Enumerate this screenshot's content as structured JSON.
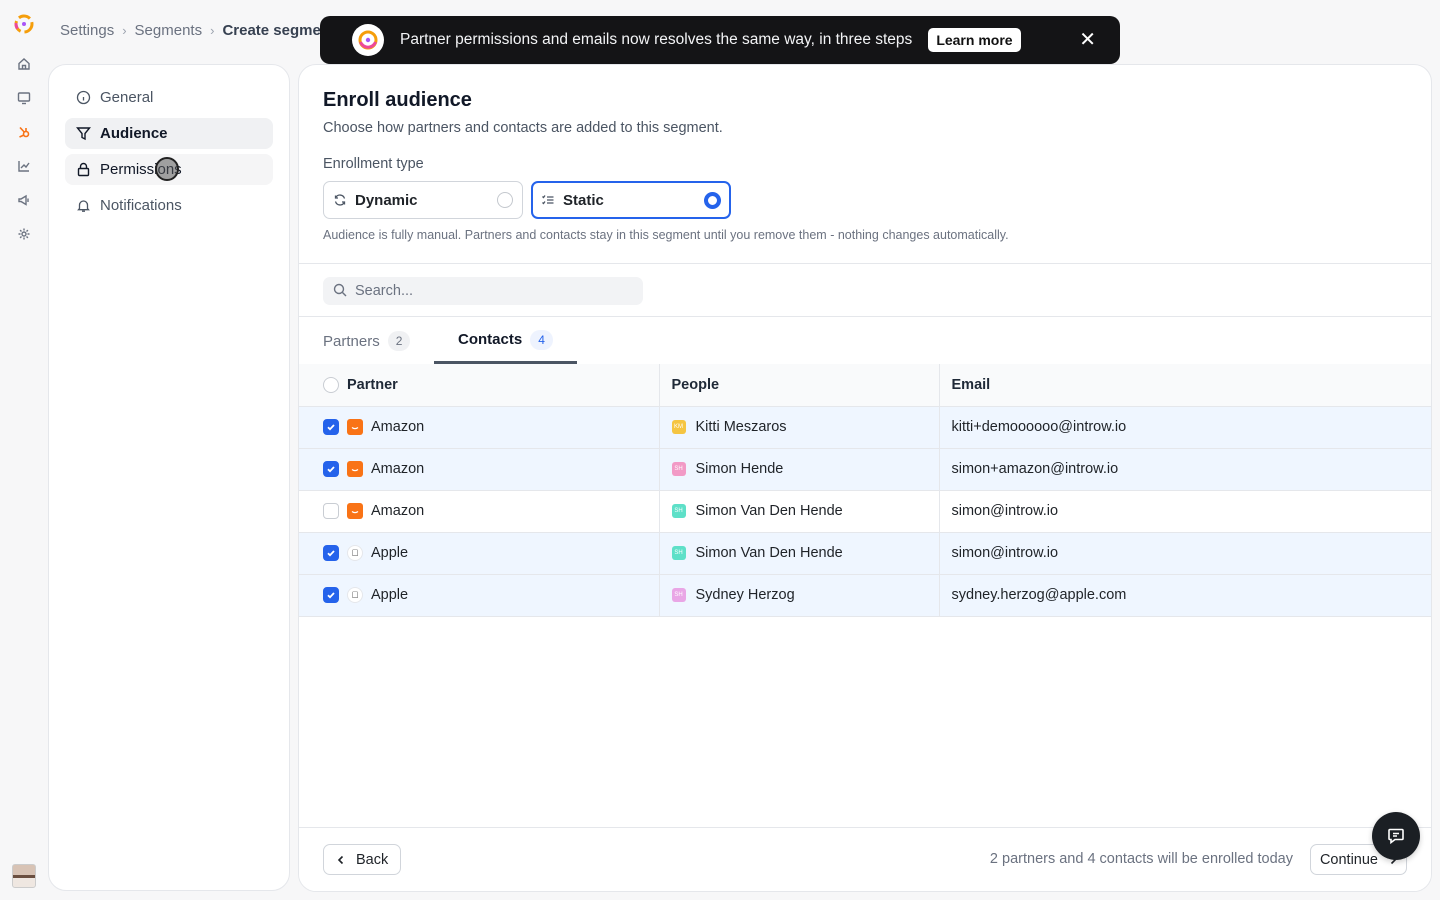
{
  "rail": {
    "icons": [
      "app-logo-icon",
      "home-icon",
      "monitor-icon",
      "hubspot-icon",
      "chart-icon",
      "megaphone-icon",
      "gear-icon",
      "user-avatar"
    ]
  },
  "breadcrumb": {
    "items": [
      "Settings",
      "Segments"
    ],
    "current": "Create segment"
  },
  "banner": {
    "text": "Partner permissions and emails now resolves the same way, in three steps",
    "button": "Learn more"
  },
  "nav": {
    "items": [
      {
        "label": "General",
        "icon": "info-icon"
      },
      {
        "label": "Audience",
        "icon": "filter-icon"
      },
      {
        "label": "Permissions",
        "icon": "lock-icon"
      },
      {
        "label": "Notifications",
        "icon": "bell-icon"
      }
    ],
    "active": "Audience"
  },
  "main": {
    "title": "Enroll audience",
    "subtitle": "Choose how partners and contacts are added to this segment.",
    "enrollment_label": "Enrollment type",
    "options": [
      {
        "label": "Dynamic",
        "icon": "refresh-icon",
        "selected": false
      },
      {
        "label": "Static",
        "icon": "list-icon",
        "selected": true
      }
    ],
    "hint": "Audience is fully manual. Partners and contacts stay in this segment until you remove them - nothing changes automatically.",
    "search_placeholder": "Search...",
    "tabs": [
      {
        "label": "Partners",
        "count": "2"
      },
      {
        "label": "Contacts",
        "count": "4"
      }
    ],
    "active_tab": "Contacts",
    "columns": [
      "Partner",
      "People",
      "Email"
    ],
    "rows": [
      {
        "checked": true,
        "partner": "Amazon",
        "partner_logo": "amazon-icon",
        "person": "Kitti Meszaros",
        "initials": "KM",
        "avatar_color": "#f5c542",
        "email": "kitti+demoooooo@introw.io"
      },
      {
        "checked": true,
        "partner": "Amazon",
        "partner_logo": "amazon-icon",
        "person": "Simon Hende",
        "initials": "SH",
        "avatar_color": "#f29ac6",
        "email": "simon+amazon@introw.io"
      },
      {
        "checked": false,
        "partner": "Amazon",
        "partner_logo": "amazon-icon",
        "person": "Simon Van Den Hende",
        "initials": "SH",
        "avatar_color": "#5ee0c8",
        "email": "simon@introw.io"
      },
      {
        "checked": true,
        "partner": "Apple",
        "partner_logo": "apple-icon",
        "person": "Simon Van Den Hende",
        "initials": "SH",
        "avatar_color": "#5ee0c8",
        "email": "simon@introw.io"
      },
      {
        "checked": true,
        "partner": "Apple",
        "partner_logo": "apple-icon",
        "person": "Sydney Herzog",
        "initials": "SH",
        "avatar_color": "#e9a6e6",
        "email": "sydney.herzog@apple.com"
      }
    ]
  },
  "footer": {
    "back": "Back",
    "summary": "2 partners and 4 contacts will be enrolled today",
    "continue": "Continue"
  },
  "colors": {
    "accent": "#2563eb",
    "banner_bg": "#141416",
    "amazon": "#f97316"
  }
}
